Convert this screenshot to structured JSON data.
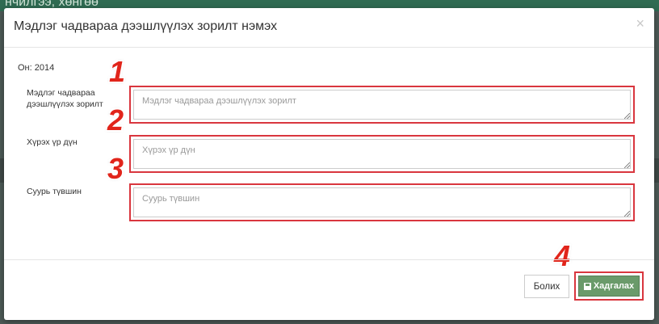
{
  "background": {
    "title_fragment": "нчилгээ, хөнгөө"
  },
  "modal": {
    "title": "Мэдлэг чадвараа дээшлүүлэх зорилт нэмэх",
    "close_glyph": "×",
    "year_text": "Он: 2014"
  },
  "fields": [
    {
      "label": "Мэдлэг чадвараа дээшлүүлэх зорилт",
      "placeholder": "Мэдлэг чадвараа дээшлүүлэх зорилт",
      "value": ""
    },
    {
      "label": "Хүрэх үр дүн",
      "placeholder": "Хүрэх үр дүн",
      "value": ""
    },
    {
      "label": "Суурь түвшин",
      "placeholder": "Суурь түвшин",
      "value": ""
    }
  ],
  "annotations": [
    "1",
    "2",
    "3",
    "4"
  ],
  "footer": {
    "cancel_label": "Болих",
    "save_label": "Хадгалах",
    "save_icon": "floppy-disk-icon"
  },
  "colors": {
    "save_button": "#6a9a6a",
    "annotation_red": "#e1251b",
    "highlight_border": "#d9363e"
  }
}
